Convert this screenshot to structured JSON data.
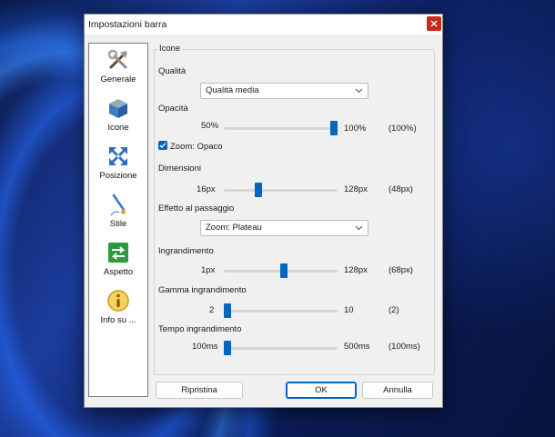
{
  "window": {
    "title": "Impostazioni barra",
    "close_label": "✕"
  },
  "sidebar": {
    "items": [
      {
        "label": "Generale",
        "icon": "tools-icon"
      },
      {
        "label": "Icone",
        "icon": "box-icon"
      },
      {
        "label": "Posizione",
        "icon": "arrows-icon"
      },
      {
        "label": "Stile",
        "icon": "brush-icon"
      },
      {
        "label": "Aspetto",
        "icon": "swap-arrows-icon"
      },
      {
        "label": "Info su ...",
        "icon": "info-icon"
      }
    ]
  },
  "group": {
    "title": "Icone"
  },
  "quality": {
    "label": "Qualità",
    "value": "Qualità media"
  },
  "opacity": {
    "label": "Opacità",
    "min": "50%",
    "max": "100%",
    "current": "(100%)",
    "level": 1.0
  },
  "zoom_opaque": {
    "label": "Zoom: Opaco",
    "checked": true
  },
  "dimensions": {
    "label": "Dimensioni",
    "min": "16px",
    "max": "128px",
    "current": "(48px)",
    "level": 0.29
  },
  "hover_effect": {
    "label": "Effetto al passaggio",
    "value": "Zoom: Plateau"
  },
  "magnification": {
    "label": "Ingrandimento",
    "min": "1px",
    "max": "128px",
    "current": "(68px)",
    "level": 0.53
  },
  "magnification_range": {
    "label": "Gamma ingrandimento",
    "min": "2",
    "max": "10",
    "current": "(2)",
    "level": 0.0
  },
  "magnification_time": {
    "label": "Tempo ingrandimento",
    "min": "100ms",
    "max": "500ms",
    "current": "(100ms)",
    "level": 0.0
  },
  "buttons": {
    "reset": "Ripristina",
    "ok": "OK",
    "cancel": "Annulla"
  },
  "colors": {
    "accent": "#0067c0",
    "close": "#c42b1c"
  }
}
